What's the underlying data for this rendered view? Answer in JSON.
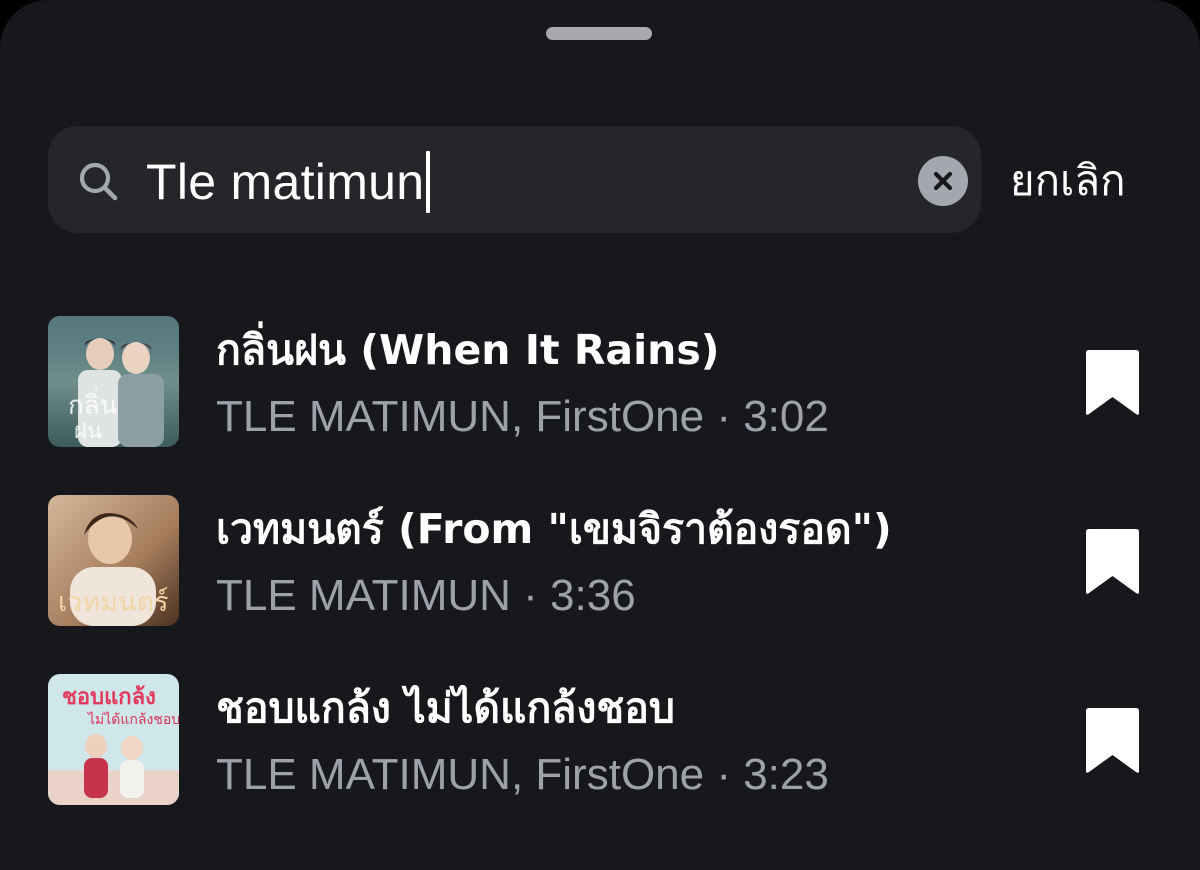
{
  "search": {
    "query": "Tle matimun",
    "cancel_label": "ยกเลิก"
  },
  "icons": {
    "search": "search-icon",
    "clear": "clear-icon",
    "bookmark": "bookmark-icon"
  },
  "colors": {
    "sheet_background": "#17181b",
    "search_field": "#24262a",
    "primary_text": "#ffffff",
    "secondary_text": "#9ea1aa",
    "clear_button": "#a4a7ad"
  },
  "results": [
    {
      "title": "กลิ่นฝน (When It Rains)",
      "meta": "TLE MATIMUN, FirstOne · 3:02"
    },
    {
      "title": "เวทมนตร์ (From \"เขมจิราต้องรอด\")",
      "meta": "TLE MATIMUN · 3:36"
    },
    {
      "title": "ชอบแกล้ง ไม่ได้แกล้งชอบ",
      "meta": "TLE MATIMUN, FirstOne · 3:23"
    }
  ]
}
